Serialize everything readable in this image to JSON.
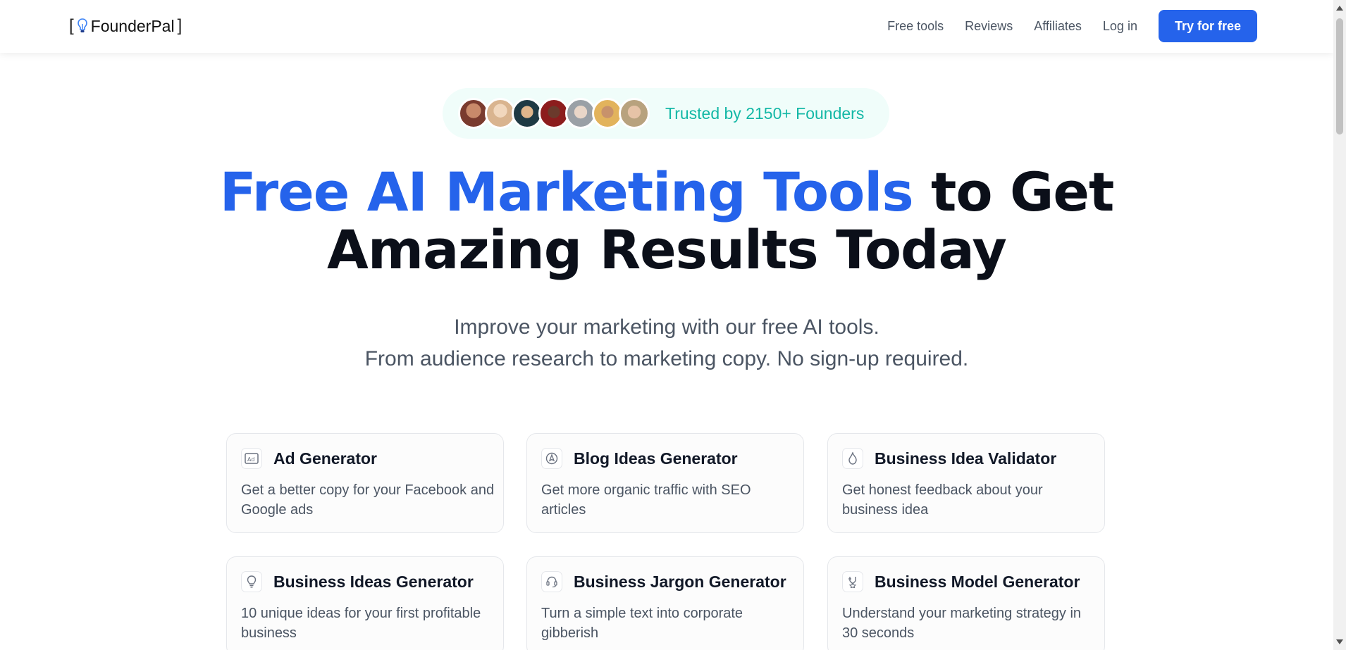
{
  "header": {
    "logo": {
      "open_bracket": "[",
      "name": "FounderPal",
      "close_bracket": "]",
      "icon": "lightbulb-icon"
    },
    "nav": [
      {
        "label": "Free tools"
      },
      {
        "label": "Reviews"
      },
      {
        "label": "Affiliates"
      },
      {
        "label": "Log in"
      }
    ],
    "cta_label": "Try for free",
    "accent_color": "#2563eb"
  },
  "trusted": {
    "text": "Trusted by 2150+ Founders",
    "avatar_colors": [
      "#7a3b2e",
      "#d9b48f",
      "#1f3a44",
      "#8c1d1d",
      "#9aa0a6",
      "#e2b35c",
      "#b8a27e"
    ]
  },
  "hero": {
    "title_accent": "Free AI Marketing Tools",
    "title_rest_line1": "to Get",
    "title_line2": "Amazing Results Today",
    "subtitle_line1": "Improve your marketing with our free AI tools.",
    "subtitle_line2": "From audience research to marketing copy. No sign-up required."
  },
  "tools": [
    {
      "title": "Ad Generator",
      "desc": "Get a better copy for your Facebook and Google ads",
      "icon": "ad-icon"
    },
    {
      "title": "Blog Ideas Generator",
      "desc": "Get more organic traffic with SEO articles",
      "icon": "pen-nib-icon"
    },
    {
      "title": "Business Idea Validator",
      "desc": "Get honest feedback about your business idea",
      "icon": "flame-icon"
    },
    {
      "title": "Business Ideas Generator",
      "desc": "10 unique ideas for your first profitable business",
      "icon": "lightbulb-icon"
    },
    {
      "title": "Business Jargon Generator",
      "desc": "Turn a simple text into corporate gibberish",
      "icon": "headset-icon"
    },
    {
      "title": "Business Model Generator",
      "desc": "Understand your marketing strategy in 30 seconds",
      "icon": "strategy-icon"
    }
  ]
}
